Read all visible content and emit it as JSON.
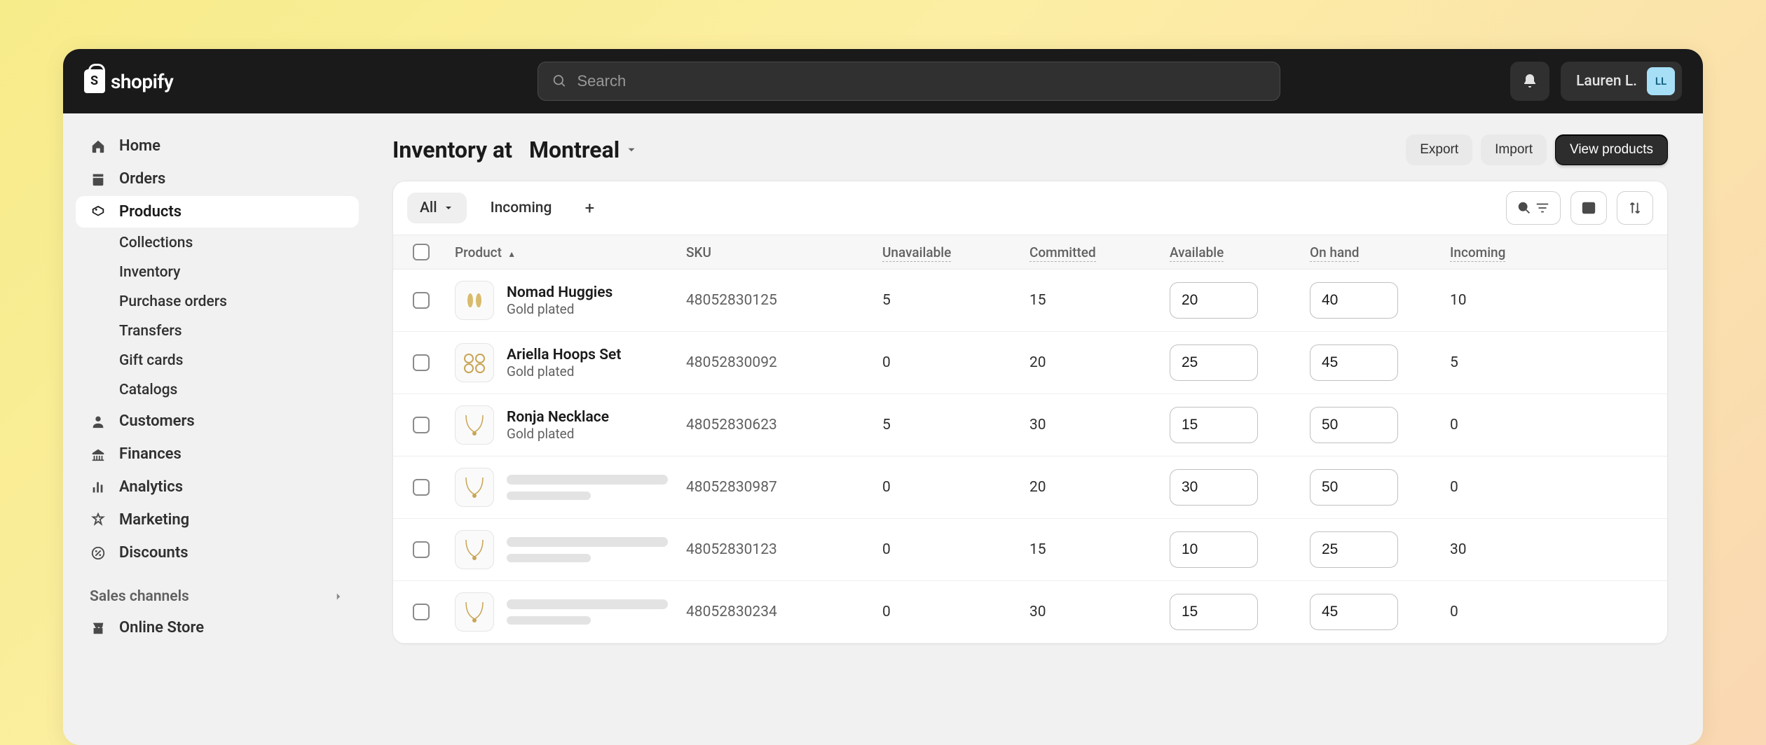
{
  "brand": "shopify",
  "search": {
    "placeholder": "Search"
  },
  "user": {
    "name": "Lauren L.",
    "initials": "LL"
  },
  "nav": {
    "home": "Home",
    "orders": "Orders",
    "products": "Products",
    "collections": "Collections",
    "inventory": "Inventory",
    "purchase_orders": "Purchase orders",
    "transfers": "Transfers",
    "gift_cards": "Gift cards",
    "catalogs": "Catalogs",
    "customers": "Customers",
    "finances": "Finances",
    "analytics": "Analytics",
    "marketing": "Marketing",
    "discounts": "Discounts",
    "sales_channels": "Sales channels",
    "online_store": "Online Store"
  },
  "page": {
    "title_prefix": "Inventory at",
    "location": "Montreal",
    "export": "Export",
    "import": "Import",
    "view_products": "View products"
  },
  "tabs": {
    "all": "All",
    "incoming": "Incoming"
  },
  "columns": {
    "product": "Product",
    "sku": "SKU",
    "unavailable": "Unavailable",
    "committed": "Committed",
    "available": "Available",
    "on_hand": "On hand",
    "incoming": "Incoming"
  },
  "rows": [
    {
      "name": "Nomad Huggies",
      "variant": "Gold plated",
      "sku": "48052830125",
      "unavailable": "5",
      "committed": "15",
      "available": "20",
      "on_hand": "40",
      "incoming": "10"
    },
    {
      "name": "Ariella Hoops Set",
      "variant": "Gold plated",
      "sku": "48052830092",
      "unavailable": "0",
      "committed": "20",
      "available": "25",
      "on_hand": "45",
      "incoming": "5"
    },
    {
      "name": "Ronja Necklace",
      "variant": "Gold plated",
      "sku": "48052830623",
      "unavailable": "5",
      "committed": "30",
      "available": "15",
      "on_hand": "50",
      "incoming": "0"
    },
    {
      "name": "",
      "variant": "",
      "sku": "48052830987",
      "unavailable": "0",
      "committed": "20",
      "available": "30",
      "on_hand": "50",
      "incoming": "0"
    },
    {
      "name": "",
      "variant": "",
      "sku": "48052830123",
      "unavailable": "0",
      "committed": "15",
      "available": "10",
      "on_hand": "25",
      "incoming": "30"
    },
    {
      "name": "",
      "variant": "",
      "sku": "48052830234",
      "unavailable": "0",
      "committed": "30",
      "available": "15",
      "on_hand": "45",
      "incoming": "0"
    }
  ]
}
